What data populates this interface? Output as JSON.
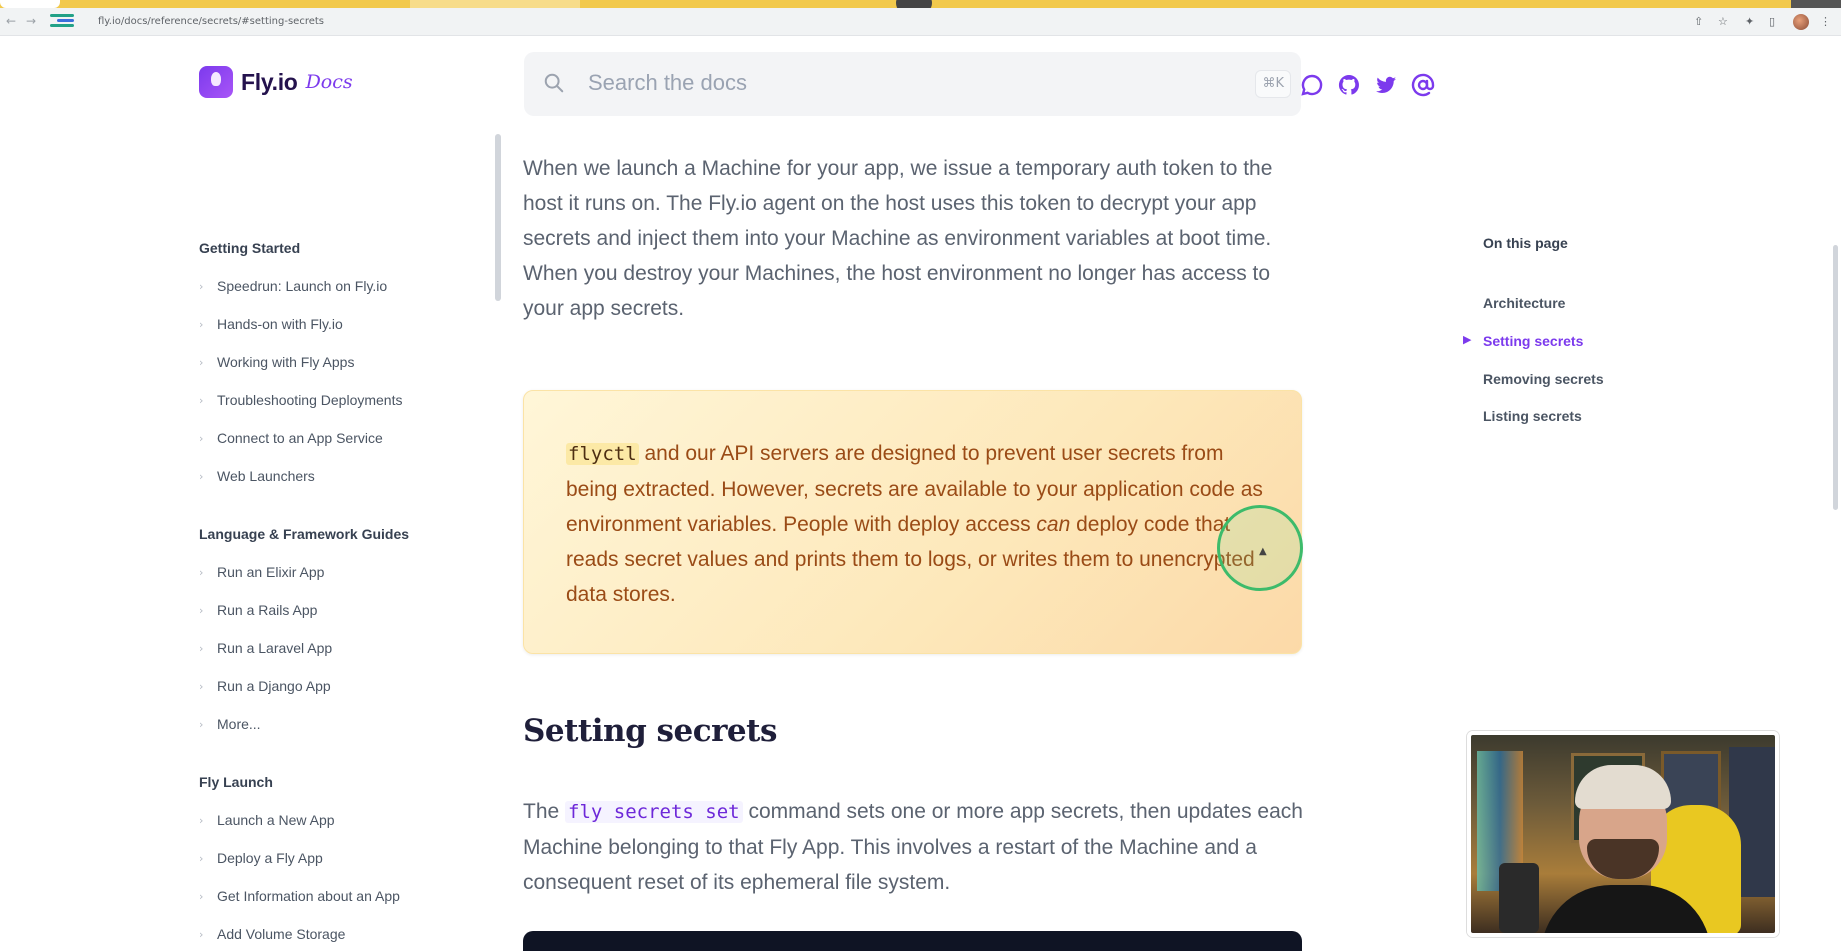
{
  "browser": {
    "url": "fly.io/docs/reference/secrets/#setting-secrets",
    "back_glyph": "←",
    "forward_glyph": "→",
    "reload_glyph": "↻",
    "extension_glyphs": [
      "⇧",
      "☆",
      "✦",
      "▯",
      "⋮"
    ]
  },
  "header": {
    "logo_text": "Fly.io",
    "logo_docs": "Docs",
    "search_placeholder": "Search the docs",
    "search_shortcut": "⌘K",
    "social_icons": [
      "chat-icon",
      "github-icon",
      "twitter-icon",
      "at-icon"
    ]
  },
  "sidebar": {
    "sections": [
      {
        "heading": "Getting Started",
        "items": [
          "Speedrun: Launch on Fly.io",
          "Hands-on with Fly.io",
          "Working with Fly Apps",
          "Troubleshooting Deployments",
          "Connect to an App Service",
          "Web Launchers"
        ]
      },
      {
        "heading": "Language & Framework Guides",
        "items": [
          "Run an Elixir App",
          "Run a Rails App",
          "Run a Laravel App",
          "Run a Django App",
          "More..."
        ]
      },
      {
        "heading": "Fly Launch",
        "items": [
          "Launch a New App",
          "Deploy a Fly App",
          "Get Information about an App",
          "Add Volume Storage"
        ]
      }
    ]
  },
  "main": {
    "intro_paragraph": "When we launch a Machine for your app, we issue a temporary auth token to the host it runs on. The Fly.io agent on the host uses this token to decrypt your app secrets and inject them into your Machine as environment variables at boot time. When you destroy your Machines, the host environment no longer has access to your app secrets.",
    "callout": {
      "code": "flyctl",
      "text_1": " and our API servers are designed to prevent user secrets from being extracted. However, secrets are available to your application code as environment variables. People with deploy access ",
      "emphasis": "can",
      "text_2": " deploy code that reads secret values and prints them to logs, or writes them to unencrypted data stores."
    },
    "section_heading": "Setting secrets",
    "setting_paragraph": {
      "text_1": "The ",
      "code": "fly secrets set",
      "text_2": " command sets one or more app secrets, then updates each Machine belonging to that Fly App. This involves a restart of the Machine and a consequent reset of its ephemeral file system."
    }
  },
  "toc": {
    "title": "On this page",
    "items": [
      "Architecture",
      "Setting secrets",
      "Removing secrets",
      "Listing secrets"
    ],
    "active": "Setting secrets"
  },
  "colors": {
    "accent": "#7c3aed",
    "callout_text": "#9a4b16",
    "callout_bg": "#fde8ba"
  }
}
